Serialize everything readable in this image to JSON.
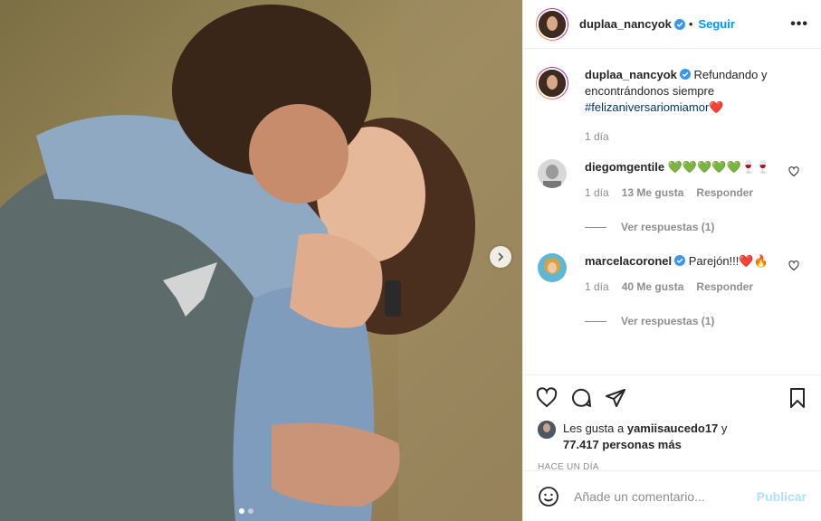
{
  "post": {
    "username": "duplaa_nancyok",
    "follow_label": "Seguir",
    "more_label": "•••",
    "carousel_dots": 2
  },
  "caption": {
    "username": "duplaa_nancyok",
    "text": "Refundando y encontrándonos siempre",
    "hashtag": "#felizaniversariomiamor",
    "emoji": "❤️",
    "time": "1 día"
  },
  "comments": [
    {
      "username": "diegomgentile",
      "text": "💚💚💚💚💚🍷🍷",
      "time": "1 día",
      "likes": "13 Me gusta",
      "reply": "Responder",
      "view_replies": "Ver respuestas (1)"
    },
    {
      "username": "marcelacoronel",
      "text": "Parejón!!!❤️🔥",
      "time": "1 día",
      "likes": "40 Me gusta",
      "reply": "Responder",
      "view_replies": "Ver respuestas (1)"
    }
  ],
  "likes_summary": {
    "prefix": "Les gusta a",
    "user": "yamiisaucedo17",
    "conj": "y",
    "count": "77.417 personas más"
  },
  "timestamp": "HACE UN DÍA",
  "add_comment": {
    "placeholder": "Añade un comentario...",
    "publish_label": "Publicar"
  },
  "colors": {
    "link": "#0095f6",
    "hashtag": "#00376b",
    "muted": "#8e8e8e",
    "publish_disabled": "#b2dffc"
  }
}
